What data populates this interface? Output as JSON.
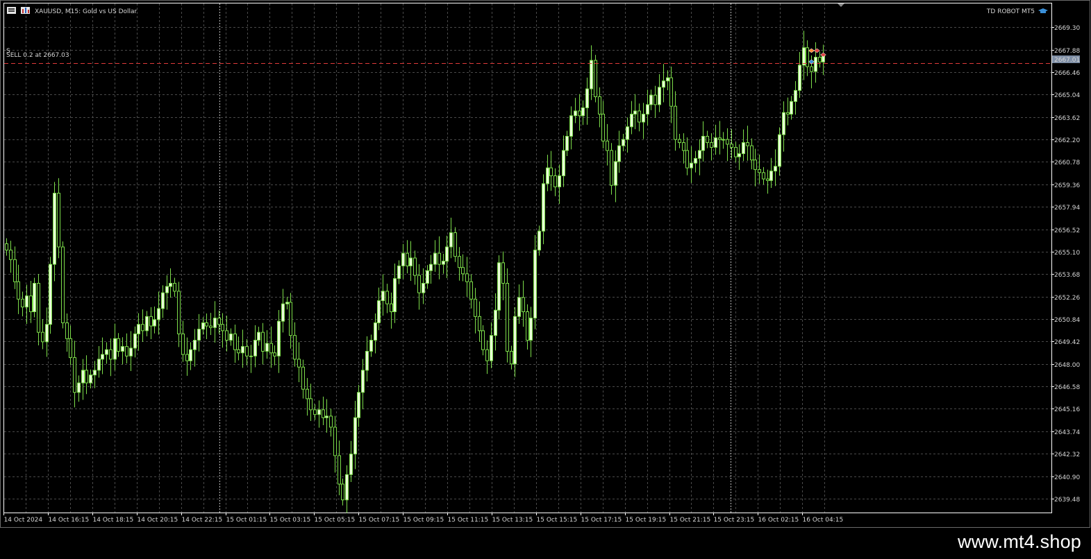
{
  "header": {
    "symbol_label": "XAUUSD, M15:  Gold vs US Dollar",
    "robot_label": "TD ROBOT MT5"
  },
  "trade": {
    "label": "SELL 0.2 at 2667.03",
    "price": 2667.01,
    "price_label": "2667.01",
    "line_color": "#e03a3a"
  },
  "footer": {
    "url": "www.mt4.shop"
  },
  "colors": {
    "background": "#000000",
    "grid": "#4a4a4a",
    "candle": "#7dde4a",
    "candle_fill_bull": "#e8ffd8",
    "axis": "#ffffff",
    "text": "#d6d6d6",
    "price_tag_bg": "#7f8fa6"
  },
  "icons": {
    "chart_menu": "chart-menu-icon",
    "robot_cap": "graduation-cap-icon"
  },
  "chart_data": {
    "type": "candlestick",
    "symbol": "XAUUSD",
    "timeframe": "M15",
    "ylim": [
      2638.6,
      2670.8
    ],
    "y_ticks": [
      "2669.30",
      "2667.88",
      "2666.46",
      "2665.04",
      "2663.62",
      "2662.20",
      "2660.78",
      "2659.36",
      "2657.94",
      "2656.52",
      "2655.10",
      "2653.68",
      "2652.26",
      "2650.84",
      "2649.42",
      "2648.00",
      "2646.58",
      "2645.16",
      "2643.74",
      "2642.32",
      "2640.90",
      "2639.48"
    ],
    "x_ticks": [
      "14 Oct 2024",
      "14 Oct 16:15",
      "14 Oct 18:15",
      "14 Oct 20:15",
      "14 Oct 22:15",
      "15 Oct 01:15",
      "15 Oct 03:15",
      "15 Oct 05:15",
      "15 Oct 07:15",
      "15 Oct 09:15",
      "15 Oct 11:15",
      "15 Oct 13:15",
      "15 Oct 15:15",
      "15 Oct 17:15",
      "15 Oct 19:15",
      "15 Oct 21:15",
      "15 Oct 23:15",
      "16 Oct 02:15",
      "16 Oct 04:15"
    ],
    "grid": true,
    "closes": [
      2655.2,
      2654.6,
      2653.2,
      2652.1,
      2651.6,
      2652.3,
      2651.3,
      2653.1,
      2650.0,
      2649.4,
      2650.5,
      2654.3,
      2658.8,
      2655.4,
      2650.6,
      2649.6,
      2648.4,
      2646.2,
      2646.8,
      2647.6,
      2646.8,
      2647.3,
      2647.6,
      2648.3,
      2648.6,
      2648.9,
      2648.3,
      2649.6,
      2648.8,
      2649.1,
      2648.5,
      2649.0,
      2649.9,
      2650.5,
      2650.1,
      2651.0,
      2650.4,
      2650.8,
      2651.5,
      2652.5,
      2652.9,
      2653.1,
      2652.6,
      2649.9,
      2648.6,
      2648.2,
      2648.9,
      2649.5,
      2650.2,
      2650.6,
      2650.4,
      2650.3,
      2650.9,
      2650.5,
      2650.1,
      2649.5,
      2649.9,
      2648.9,
      2648.7,
      2649.1,
      2648.5,
      2648.5,
      2649.5,
      2650.0,
      2648.8,
      2649.3,
      2648.7,
      2648.5,
      2650.7,
      2651.8,
      2651.9,
      2649.8,
      2648.3,
      2647.8,
      2646.4,
      2645.8,
      2645.1,
      2644.8,
      2645.1,
      2644.6,
      2644.7,
      2644.0,
      2642.2,
      2640.4,
      2639.4,
      2641.0,
      2642.3,
      2644.6,
      2646.2,
      2647.6,
      2648.8,
      2649.5,
      2650.6,
      2652.0,
      2652.6,
      2651.8,
      2651.3,
      2653.4,
      2654.2,
      2655.0,
      2654.2,
      2654.7,
      2653.6,
      2652.5,
      2653.1,
      2653.9,
      2654.3,
      2655.0,
      2654.3,
      2654.5,
      2655.4,
      2656.3,
      2654.8,
      2654.1,
      2653.7,
      2653.2,
      2652.1,
      2651.0,
      2650.1,
      2648.9,
      2648.2,
      2649.8,
      2651.4,
      2654.4,
      2653.1,
      2648.8,
      2648.0,
      2651.0,
      2652.2,
      2651.3,
      2649.5,
      2650.9,
      2655.2,
      2656.4,
      2659.4,
      2660.4,
      2659.9,
      2659.2,
      2659.9,
      2661.5,
      2662.4,
      2663.7,
      2664.0,
      2663.7,
      2664.2,
      2665.4,
      2667.2,
      2664.9,
      2663.8,
      2662.1,
      2661.5,
      2659.3,
      2660.8,
      2661.8,
      2662.2,
      2663.0,
      2663.8,
      2664.0,
      2663.3,
      2663.8,
      2664.4,
      2665.0,
      2664.4,
      2665.5,
      2665.9,
      2666.1,
      2664.3,
      2662.2,
      2662.0,
      2661.5,
      2660.4,
      2660.7,
      2661.0,
      2661.5,
      2662.4,
      2662.0,
      2661.7,
      2662.3,
      2662.2,
      2662.2,
      2661.9,
      2661.7,
      2661.1,
      2661.3,
      2662.0,
      2661.8,
      2660.9,
      2660.3,
      2660.1,
      2659.7,
      2659.6,
      2660.2,
      2660.5,
      2662.5,
      2663.9,
      2663.8,
      2664.6,
      2665.3,
      2666.9,
      2668.0,
      2666.8,
      2666.5,
      2667.4,
      2667.1,
      2667.6
    ]
  }
}
